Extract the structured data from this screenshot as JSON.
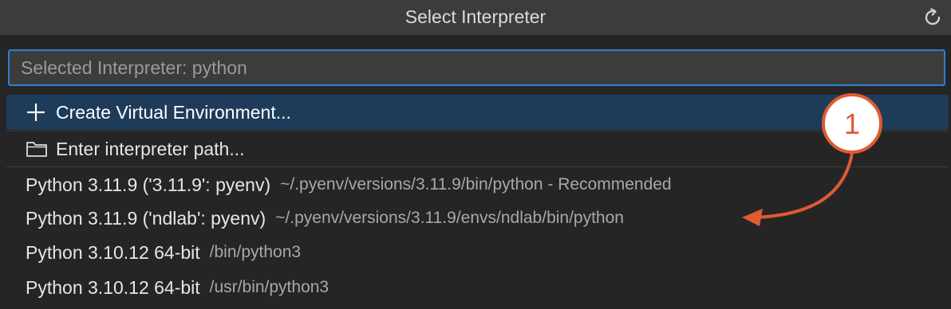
{
  "header": {
    "title": "Select Interpreter",
    "refresh_icon": "refresh-icon"
  },
  "search": {
    "placeholder": "Selected Interpreter: python",
    "value": ""
  },
  "actions": [
    {
      "label": "Create Virtual Environment...",
      "icon": "plus-icon"
    },
    {
      "label": "Enter interpreter path...",
      "icon": "folder-icon"
    }
  ],
  "interpreters": [
    {
      "name": "Python 3.11.9 ('3.11.9': pyenv)",
      "path": "~/.pyenv/versions/3.11.9/bin/python - Recommended"
    },
    {
      "name": "Python 3.11.9 ('ndlab': pyenv)",
      "path": "~/.pyenv/versions/3.11.9/envs/ndlab/bin/python"
    },
    {
      "name": "Python 3.10.12 64-bit",
      "path": "/bin/python3"
    },
    {
      "name": "Python 3.10.12 64-bit",
      "path": "/usr/bin/python3"
    }
  ],
  "annotation": {
    "number": "1",
    "color": "#e05a32"
  },
  "colors": {
    "accent": "#2f7fd2",
    "selected_bg": "#1f3b5a"
  }
}
